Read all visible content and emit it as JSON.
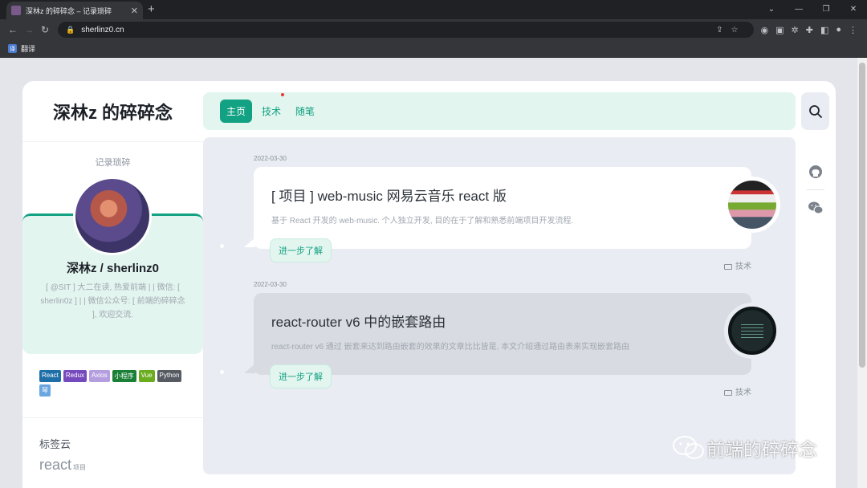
{
  "browser": {
    "tab_title": "深林z 的碎碎念 – 记录琐碎",
    "url": "sherlinz0.cn",
    "bookmark_label": "翻译"
  },
  "site": {
    "brand": "深林z 的碎碎念",
    "nav": [
      "主页",
      "技术",
      "随笔"
    ],
    "sidebar": {
      "tagline": "记录琐碎",
      "name": "深林z / sherlinz0",
      "bio": "[ @SIT ] 大二在读, 热爱前端 | | 微信: [ sherlin0z ] | | 微信公众号: [ 前端的碎碎念 ], 欢迎交流.",
      "tags": [
        {
          "label": "React",
          "color": "#1e6fa8"
        },
        {
          "label": "Redux",
          "color": "#764abc"
        },
        {
          "label": "Axios",
          "color": "#b59ee0"
        },
        {
          "label": "小程序",
          "color": "#1a7f37"
        },
        {
          "label": "Vue",
          "color": "#6bad1f"
        },
        {
          "label": "Python",
          "color": "#555b61"
        },
        {
          "label": "琴",
          "color": "#6aa6e0"
        }
      ],
      "cloud_title": "标签云",
      "cloud_big": "react",
      "cloud_small": "项目"
    },
    "posts": [
      {
        "date": "2022-03-30",
        "title": "[ 项目 ] web-music 网易云音乐 react 版",
        "desc": "基于 React 开发的 web-music. 个人独立开发, 目的在于了解和熟悉前端项目开发流程.",
        "more": "进一步了解",
        "category": "技术"
      },
      {
        "date": "2022-03-30",
        "title": "react-router v6 中的嵌套路由",
        "desc": "react-router v6 通过 嵌套来达到路由嵌套的效果的文章比比皆是, 本文介绍通过路由表来实现嵌套路由",
        "more": "进一步了解",
        "category": "技术"
      }
    ]
  },
  "watermark": "前端的碎碎念"
}
